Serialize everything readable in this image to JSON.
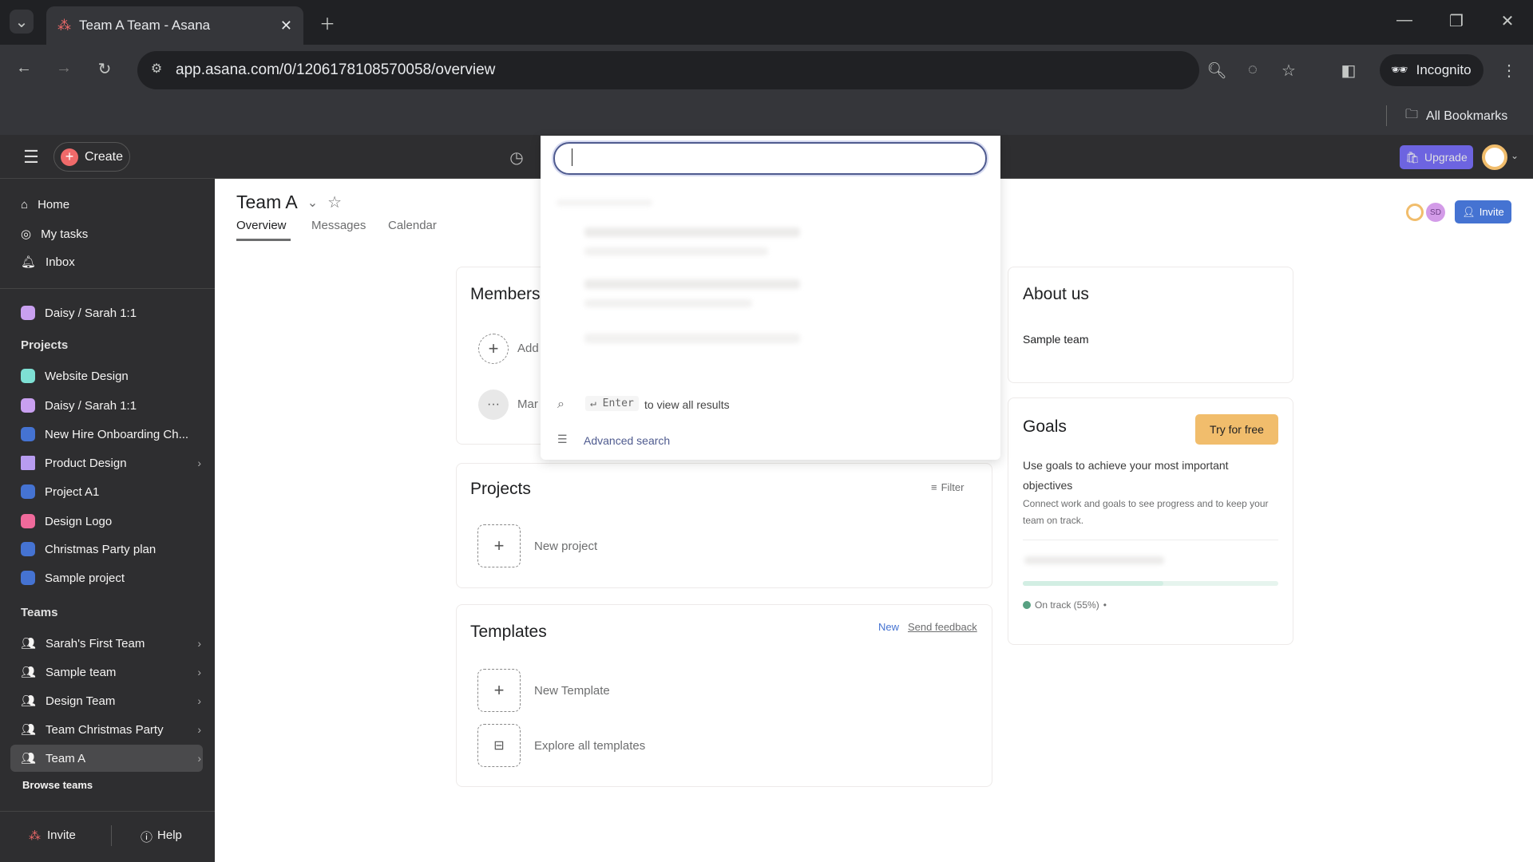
{
  "browser": {
    "tab_title": "Team A Team - Asana",
    "url": "app.asana.com/0/1206178108570058/overview",
    "incognito_label": "Incognito",
    "bookmarks_label": "All Bookmarks"
  },
  "topbar": {
    "create_label": "Create",
    "upgrade_label": "Upgrade",
    "search_value": ""
  },
  "sidebar": {
    "nav": [
      {
        "label": "Home",
        "icon": "home-icon"
      },
      {
        "label": "My tasks",
        "icon": "check-circle-icon"
      },
      {
        "label": "Inbox",
        "icon": "bell-icon"
      }
    ],
    "pinned": [
      {
        "label": "Daisy / Sarah 1:1",
        "color": "#c9a0f0"
      }
    ],
    "projects_header": "Projects",
    "projects": [
      {
        "label": "Website Design",
        "color": "#7ee0d4"
      },
      {
        "label": "Daisy / Sarah 1:1",
        "color": "#c9a0f0"
      },
      {
        "label": "New Hire Onboarding Ch...",
        "color": "#4573d2"
      },
      {
        "label": "Product Design",
        "color": "#b89cf0",
        "folder": true
      },
      {
        "label": "Project A1",
        "color": "#4573d2"
      },
      {
        "label": "Design Logo",
        "color": "#f06a9b"
      },
      {
        "label": "Christmas Party plan",
        "color": "#4573d2"
      },
      {
        "label": "Sample project",
        "color": "#4573d2"
      }
    ],
    "teams_header": "Teams",
    "teams": [
      {
        "label": "Sarah's First Team"
      },
      {
        "label": "Sample team"
      },
      {
        "label": "Design Team"
      },
      {
        "label": "Team Christmas Party"
      },
      {
        "label": "Team A",
        "active": true
      }
    ],
    "browse_teams": "Browse teams",
    "invite_label": "Invite",
    "help_label": "Help"
  },
  "header": {
    "title": "Team A",
    "tabs": [
      "Overview",
      "Messages",
      "Calendar"
    ],
    "active_tab": "Overview",
    "invite_label": "Invite",
    "avatar_initials": "SD"
  },
  "search_dropdown": {
    "enter_key": "Enter",
    "enter_hint": "to view all results",
    "advanced": "Advanced search"
  },
  "members": {
    "title": "Members",
    "add_label": "Add",
    "more_label": "Mar"
  },
  "projects_card": {
    "title": "Projects",
    "filter_label": "Filter",
    "new_label": "New project"
  },
  "templates": {
    "title": "Templates",
    "new_badge": "New",
    "feedback_link": "Send feedback",
    "new_template": "New Template",
    "explore": "Explore all templates"
  },
  "about": {
    "title": "About us",
    "text": "Sample team"
  },
  "goals": {
    "title": "Goals",
    "try_label": "Try for free",
    "headline": "Use goals to achieve your most important objectives",
    "sub": "Connect work and goals to see progress and to keep your team on track.",
    "status": "On track (55%)",
    "progress_percent": 55
  },
  "colors": {
    "accent_blue": "#4573d2",
    "upgrade": "#796eff",
    "try_button": "#f1bd6c",
    "on_track": "#58a182"
  }
}
